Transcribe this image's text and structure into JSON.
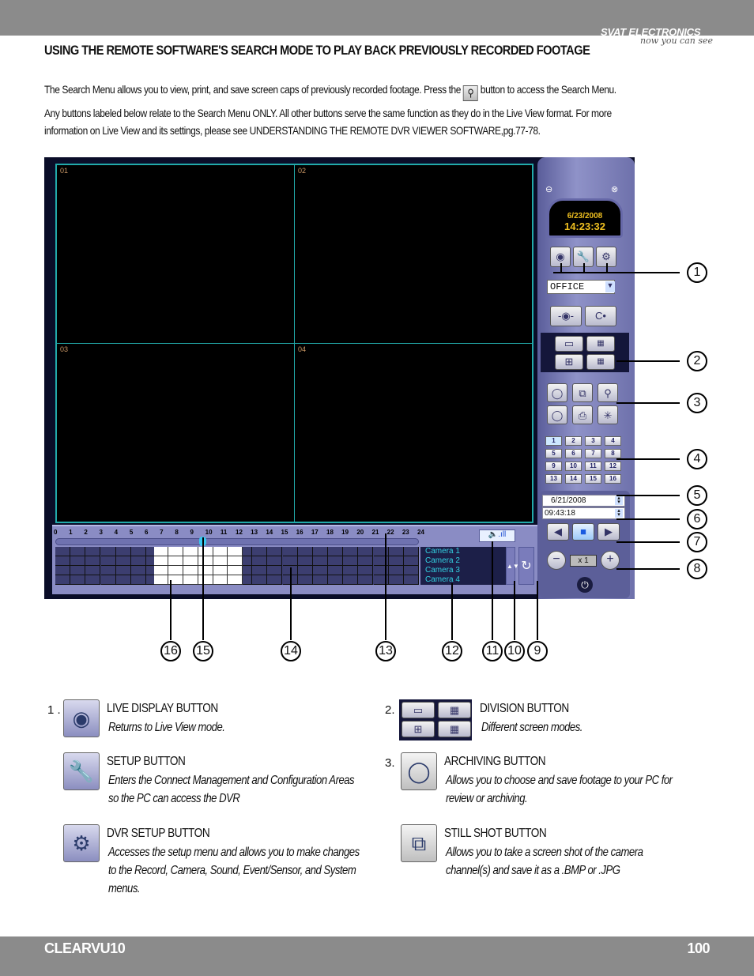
{
  "header": {
    "brand": "SVAT ELECTRONICS",
    "tagline": "now you can see"
  },
  "title": "USING THE REMOTE SOFTWARE'S SEARCH MODE TO PLAY BACK PREVIOUSLY RECORDED FOOTAGE",
  "intro": {
    "line1_before": "The Search Menu allows you to view, print, and save screen caps of previously recorded footage.  Press the",
    "line1_after": "button to access the Search Menu.",
    "line2": "Any  buttons labeled below relate to the Search Menu ONLY.  All other buttons serve the same function as they do in the Live View format.  For more",
    "line3": "information on Live View and its settings, please see UNDERSTANDING THE REMOTE DVR VIEWER SOFTWARE,pg.77-78."
  },
  "screenshot": {
    "channels": [
      "01",
      "02",
      "03",
      "04"
    ],
    "clock": {
      "date": "6/23/2008",
      "time": "14:23:32"
    },
    "site": "OFFICE",
    "channel_buttons": [
      "1",
      "2",
      "3",
      "4",
      "5",
      "6",
      "7",
      "8",
      "9",
      "10",
      "11",
      "12",
      "13",
      "14",
      "15",
      "16"
    ],
    "selected_channel": "1",
    "search_date": "6/21/2008",
    "search_time": "09:43:18",
    "speed": "x 1",
    "hours": [
      "0",
      "1",
      "2",
      "3",
      "4",
      "5",
      "6",
      "7",
      "8",
      "9",
      "10",
      "11",
      "12",
      "13",
      "14",
      "15",
      "16",
      "17",
      "18",
      "19",
      "20",
      "21",
      "22",
      "23",
      "24"
    ],
    "playback_hour": 9.72,
    "recorded_hours": [
      6.5,
      12.3
    ],
    "cameras": [
      "Camera 1",
      "Camera 2",
      "Camera 3",
      "Camera 4"
    ],
    "colors": {
      "video_border": "#22aaaa",
      "clock_text": "#f0c020",
      "camera_text": "#33d0e0",
      "panel": "#8f92c8"
    }
  },
  "callouts": {
    "right": [
      "1",
      "2",
      "3",
      "4",
      "5",
      "6",
      "7",
      "8"
    ],
    "bottom": [
      "16",
      "15",
      "14",
      "13",
      "12",
      "11",
      "10",
      "9"
    ]
  },
  "items": [
    {
      "num": "1 .",
      "title": "LIVE DISPLAY BUTTON",
      "desc": [
        "Returns to Live View mode."
      ],
      "icon": "eye-icon"
    },
    {
      "num": "",
      "title": "SETUP BUTTON",
      "desc": [
        "Enters the Connect Management and Configuration Areas",
        "so the PC can access the DVR"
      ],
      "icon": "wrench-icon"
    },
    {
      "num": "",
      "title": "DVR SETUP BUTTON",
      "desc": [
        "Accesses the setup menu and allows you to make changes",
        "to the Record, Camera, Sound, Event/Sensor, and System",
        "menus."
      ],
      "icon": "gear-icon"
    },
    {
      "num": "2.",
      "title": "DIVISION BUTTON",
      "desc": [
        "Different screen modes."
      ],
      "icon": "division-icon"
    },
    {
      "num": "3.",
      "title": "ARCHIVING BUTTON",
      "desc": [
        "Allows you to choose and save footage to your PC for",
        "review or archiving."
      ],
      "icon": "archive-icon"
    },
    {
      "num": "",
      "title": "STILL SHOT BUTTON",
      "desc": [
        "Allows you to take a screen shot of the camera",
        "channel(s) and save it as a .BMP or .JPG"
      ],
      "icon": "still-shot-icon"
    }
  ],
  "footer": {
    "model": "CLEARVU10",
    "page": "100"
  }
}
